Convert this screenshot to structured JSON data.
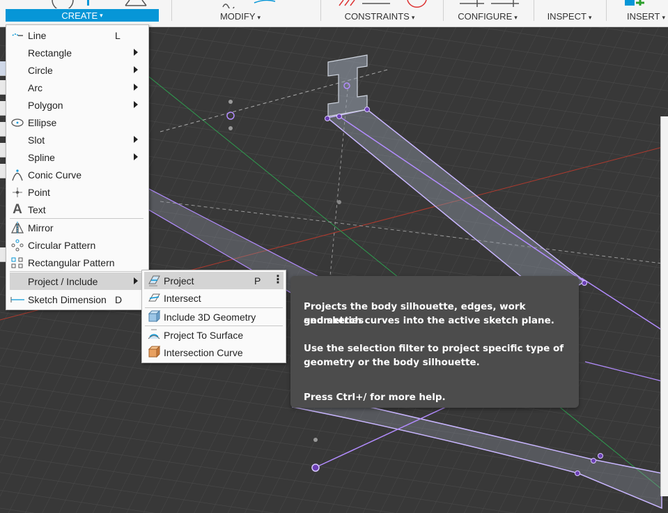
{
  "toolbar": {
    "create_label": "CREATE",
    "modify_label": "MODIFY",
    "constraints_label": "CONSTRAINTS",
    "configure_label": "CONFIGURE",
    "inspect_label": "INSPECT",
    "insert_label": "INSERT",
    "caret": "▾"
  },
  "create_menu": {
    "items": [
      {
        "label": "Line",
        "shortcut": "L",
        "icon": "line-icon"
      },
      {
        "label": "Rectangle",
        "icon": "none"
      },
      {
        "label": "Circle",
        "icon": "none"
      },
      {
        "label": "Arc",
        "icon": "none"
      },
      {
        "label": "Polygon",
        "icon": "none"
      },
      {
        "label": "Ellipse",
        "icon": "ellipse-icon"
      },
      {
        "label": "Slot",
        "icon": "none"
      },
      {
        "label": "Spline",
        "icon": "none"
      },
      {
        "label": "Conic Curve",
        "icon": "conic-curve-icon"
      },
      {
        "label": "Point",
        "icon": "point-icon"
      },
      {
        "label": "Text",
        "icon": "text-icon"
      },
      {
        "label": "Mirror",
        "icon": "mirror-icon"
      },
      {
        "label": "Circular Pattern",
        "icon": "circular-pattern-icon"
      },
      {
        "label": "Rectangular Pattern",
        "icon": "rectangular-pattern-icon"
      },
      {
        "label": "Project / Include",
        "icon": "none"
      },
      {
        "label": "Sketch Dimension",
        "shortcut": "D",
        "icon": "sketch-dimension-icon"
      }
    ],
    "text_glyph": "A"
  },
  "project_submenu": {
    "items": [
      {
        "label": "Project",
        "shortcut": "P",
        "icon": "project-icon"
      },
      {
        "label": "Intersect",
        "icon": "intersect-icon"
      },
      {
        "label": "Include 3D Geometry",
        "icon": "include-3d-geometry-icon"
      },
      {
        "label": "Project To Surface",
        "icon": "project-to-surface-icon"
      },
      {
        "label": "Intersection Curve",
        "icon": "intersection-curve-icon"
      }
    ],
    "more_glyph": "⋮"
  },
  "tooltip": {
    "line1": "Projects the body silhouette, edges, work geometries",
    "line2": "and sketch curves into the active sketch plane.",
    "line3": "Use the selection filter to project specific type of",
    "line4": "geometry or the body silhouette.",
    "line5": "Press Ctrl+/ for more help."
  },
  "colors": {
    "accent": "#0696d7",
    "canvas_bg": "#3a3a3a",
    "sketch_purple": "#b38cff",
    "axis_red": "#c0392b",
    "axis_green": "#27ae60"
  }
}
